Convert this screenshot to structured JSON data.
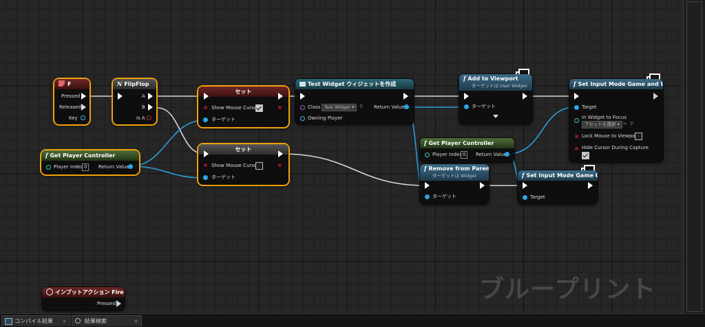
{
  "editor": {
    "watermark": "ブループリント",
    "tabs": [
      {
        "label": "コンパイル結果",
        "close": "×"
      },
      {
        "label": "結果検索",
        "close": "×"
      }
    ]
  },
  "nodes": {
    "key_f": {
      "title": "F",
      "pins": {
        "pressed": "Pressed",
        "released": "Released",
        "key": "Key"
      }
    },
    "flipflop": {
      "title": "FlipFlop",
      "pins": {
        "a": "A",
        "b": "B",
        "is_a": "Is A"
      }
    },
    "set_top": {
      "title": "セット",
      "pins": {
        "show_mouse_cursor": "Show Mouse Cursor",
        "target": "ターゲット"
      },
      "show_mouse_cursor": true
    },
    "set_bottom": {
      "title": "セット",
      "pins": {
        "show_mouse_cursor": "Show Mouse Cursor",
        "target": "ターゲット"
      },
      "show_mouse_cursor": false
    },
    "get_player_controller_left": {
      "title": "Get Player Controller",
      "pins": {
        "player_index": "Player Index",
        "player_index_value": "0",
        "return_value": "Return Value"
      }
    },
    "create_widget": {
      "title": "Test Widget ウィジェットを作成",
      "pins": {
        "class": "Class",
        "class_value": "Test Widget",
        "owning_player": "Owning Player",
        "return_value": "Return Value"
      }
    },
    "add_to_viewport": {
      "title": "Add to Viewport",
      "subtitle": "ターゲットは User Widget",
      "pins": {
        "target": "ターゲット"
      }
    },
    "get_player_controller_mid": {
      "title": "Get Player Controller",
      "pins": {
        "player_index": "Player Index",
        "player_index_value": "0",
        "return_value": "Return Value"
      }
    },
    "remove_from_parent": {
      "title": "Remove from Parent",
      "subtitle": "ターゲットは Widget",
      "pins": {
        "target": "ターゲット"
      }
    },
    "set_input_game_ui": {
      "title": "Set Input Mode Game and UI",
      "pins": {
        "target": "Target",
        "in_widget_to_focus": "In Widget to Focus",
        "asset_select": "アセットを選択",
        "lock_mouse": "Lock Mouse to Viewport",
        "hide_cursor": "Hide Cursor During Capture"
      },
      "lock_mouse": false,
      "hide_cursor": true
    },
    "set_input_game_only": {
      "title": "Set Input Mode Game Only",
      "pins": {
        "target": "Target"
      }
    },
    "input_action_fire": {
      "title": "インプットアクション Fire",
      "pins": {
        "pressed": "Pressed"
      }
    }
  },
  "colors": {
    "exec": "#ffffff",
    "object": "#2ba5e6",
    "bool": "#8c1a1a",
    "selected": "#f2a20a",
    "wire": "#2b9fd9"
  }
}
